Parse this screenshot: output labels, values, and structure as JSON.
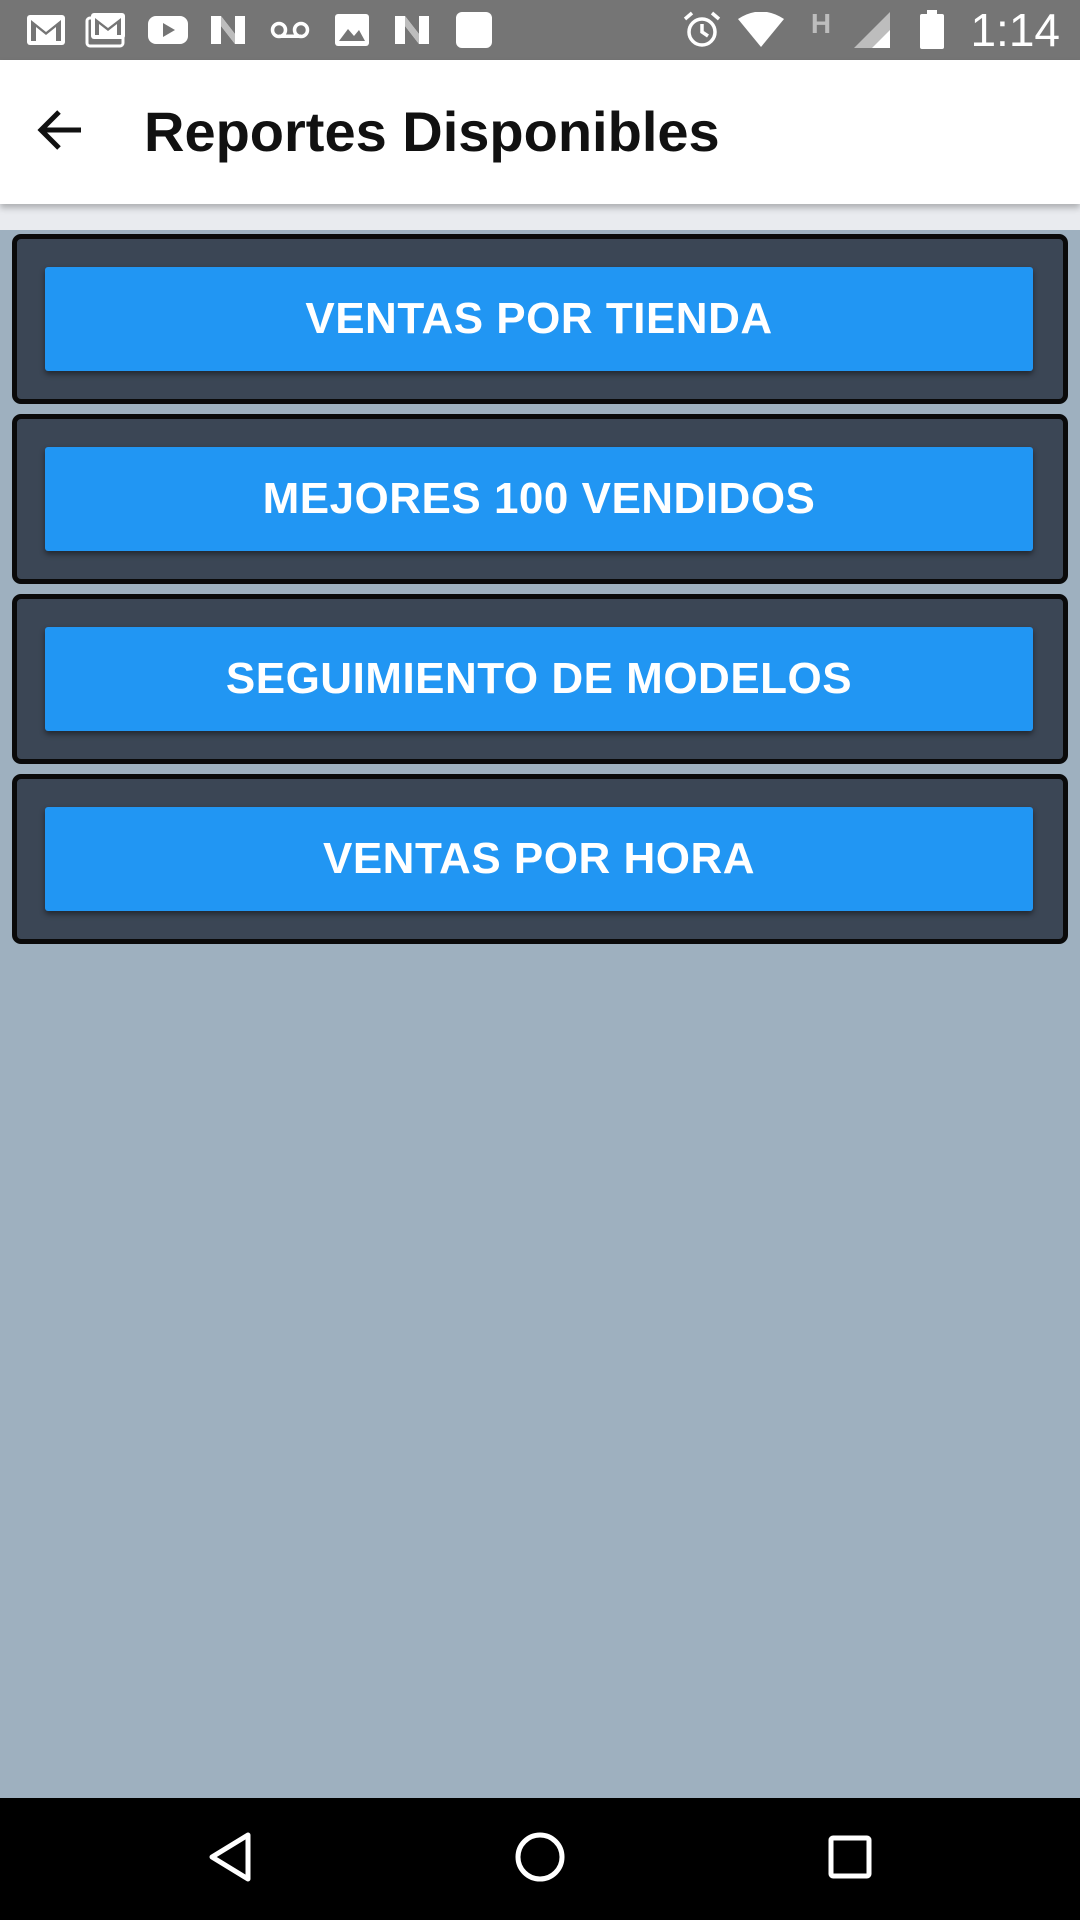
{
  "status_bar": {
    "time": "1:14",
    "left_icons": [
      "gmail-icon",
      "gmail-icon",
      "youtube-icon",
      "n-app-icon",
      "voicemail-icon",
      "image-icon",
      "n-app-icon",
      "square-app-icon"
    ],
    "right_icons": [
      "alarm-icon",
      "wifi-icon",
      "network-h-icon",
      "signal-icon",
      "battery-icon"
    ],
    "network_label": "H"
  },
  "app_bar": {
    "back_icon": "arrow-back-icon",
    "title": "Reportes Disponibles"
  },
  "reports": [
    {
      "label": "VENTAS POR TIENDA"
    },
    {
      "label": "MEJORES 100 VENDIDOS"
    },
    {
      "label": "SEGUIMIENTO DE MODELOS"
    },
    {
      "label": "VENTAS POR HORA"
    }
  ],
  "colors": {
    "status_bar_bg": "#757575",
    "app_bar_bg": "#ffffff",
    "page_bg": "#9eb0bf",
    "card_bg": "#3b4655",
    "card_border": "#0a0a0a",
    "button_bg": "#2196f3",
    "button_text": "#ffffff",
    "nav_bar_bg": "#000000"
  },
  "nav_bar": {
    "buttons": [
      "back-triangle-icon",
      "home-circle-icon",
      "recents-square-icon"
    ]
  }
}
